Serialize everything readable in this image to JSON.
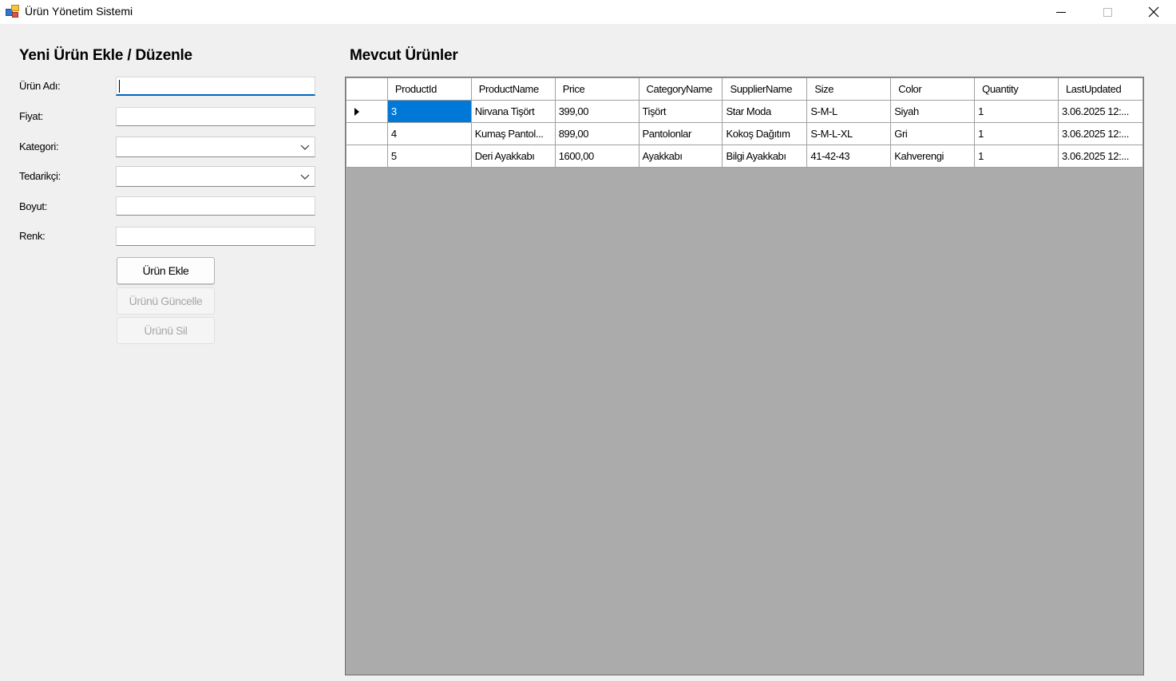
{
  "window": {
    "title": "Ürün Yönetim Sistemi"
  },
  "form": {
    "title": "Yeni Ürün Ekle / Düzenle",
    "fields": {
      "name_label": "Ürün Adı:",
      "price_label": "Fiyat:",
      "category_label": "Kategori:",
      "supplier_label": "Tedarikçi:",
      "size_label": "Boyut:",
      "color_label": "Renk:",
      "name_value": "",
      "price_value": "",
      "category_value": "",
      "supplier_value": "",
      "size_value": "",
      "color_value": ""
    },
    "buttons": {
      "add": "Ürün Ekle",
      "update": "Ürünü Güncelle",
      "delete": "Ürünü Sil"
    }
  },
  "grid": {
    "title": "Mevcut Ürünler",
    "columns": [
      "ProductId",
      "ProductName",
      "Price",
      "CategoryName",
      "SupplierName",
      "Size",
      "Color",
      "Quantity",
      "LastUpdated"
    ],
    "rows": [
      [
        "3",
        "Nirvana Tişört",
        "399,00",
        "Tişört",
        "Star Moda",
        "S-M-L",
        "Siyah",
        "1",
        "3.06.2025 12:..."
      ],
      [
        "4",
        "Kumaş Pantol...",
        "899,00",
        "Pantolonlar",
        "Kokoş Dağıtım",
        "S-M-L-XL",
        "Gri",
        "1",
        "3.06.2025 12:..."
      ],
      [
        "5",
        "Deri Ayakkabı",
        "1600,00",
        "Ayakkabı",
        "Bilgi Ayakkabı",
        "41-42-43",
        "Kahverengi",
        "1",
        "3.06.2025 12:..."
      ]
    ]
  },
  "colors": {
    "accent": "#0078d7",
    "focus_border": "#0067c0",
    "grid_background": "#ababab",
    "window_background": "#f0f0f0"
  }
}
